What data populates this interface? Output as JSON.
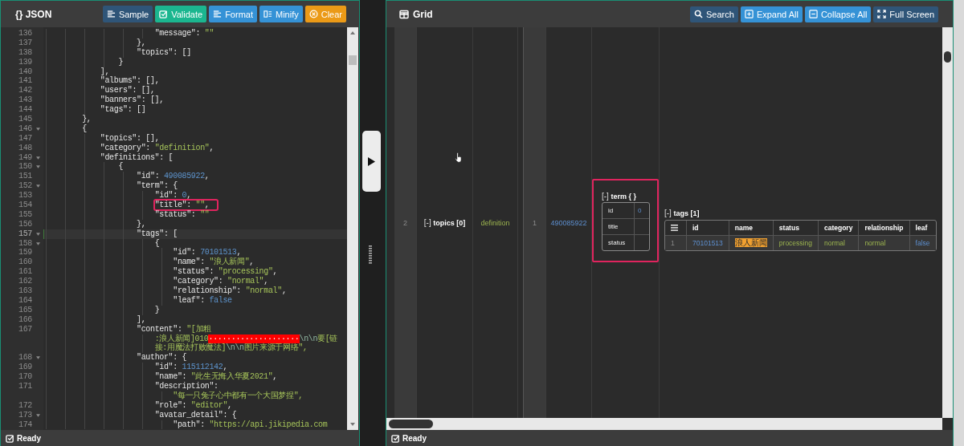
{
  "json_panel": {
    "title": "{} JSON",
    "buttons": [
      {
        "label": "Sample",
        "kind": "sample"
      },
      {
        "label": "Validate",
        "kind": "validate"
      },
      {
        "label": "Format",
        "kind": "format"
      },
      {
        "label": "Minify",
        "kind": "minify"
      },
      {
        "label": "Clear",
        "kind": "clear"
      }
    ],
    "lines": [
      {
        "kind": "code",
        "number": "136",
        "foldable": false,
        "active": false,
        "annotated": false,
        "text": "                        \"message\": \"\""
      },
      {
        "kind": "code",
        "number": "137",
        "foldable": false,
        "active": false,
        "annotated": false,
        "text": "                    },"
      },
      {
        "kind": "code",
        "number": "138",
        "foldable": false,
        "active": false,
        "annotated": false,
        "text": "                    \"topics\": []"
      },
      {
        "kind": "code",
        "number": "139",
        "foldable": false,
        "active": false,
        "annotated": false,
        "text": "                }"
      },
      {
        "kind": "code",
        "number": "140",
        "foldable": false,
        "active": false,
        "annotated": false,
        "text": "            ],"
      },
      {
        "kind": "code",
        "number": "141",
        "foldable": false,
        "active": false,
        "annotated": false,
        "text": "            \"albums\": [],"
      },
      {
        "kind": "code",
        "number": "142",
        "foldable": false,
        "active": false,
        "annotated": false,
        "text": "            \"users\": [],"
      },
      {
        "kind": "code",
        "number": "143",
        "foldable": false,
        "active": false,
        "annotated": false,
        "text": "            \"banners\": [],"
      },
      {
        "kind": "code",
        "number": "144",
        "foldable": false,
        "active": false,
        "annotated": false,
        "text": "            \"tags\": []"
      },
      {
        "kind": "code",
        "number": "145",
        "foldable": false,
        "active": false,
        "annotated": false,
        "text": "        },"
      },
      {
        "kind": "code",
        "number": "146",
        "foldable": true,
        "active": false,
        "annotated": false,
        "text": "        {"
      },
      {
        "kind": "code",
        "number": "147",
        "foldable": false,
        "active": false,
        "annotated": false,
        "text": "            \"topics\": [],"
      },
      {
        "kind": "code",
        "number": "148",
        "foldable": false,
        "active": false,
        "annotated": false,
        "text": "            \"category\": \"definition\","
      },
      {
        "kind": "code",
        "number": "149",
        "foldable": true,
        "active": false,
        "annotated": false,
        "text": "            \"definitions\": ["
      },
      {
        "kind": "code",
        "number": "150",
        "foldable": true,
        "active": false,
        "annotated": false,
        "text": "                {"
      },
      {
        "kind": "code",
        "number": "151",
        "foldable": false,
        "active": false,
        "annotated": false,
        "text": "                    \"id\": 490085922,"
      },
      {
        "kind": "code",
        "number": "152",
        "foldable": true,
        "active": false,
        "annotated": false,
        "text": "                    \"term\": {"
      },
      {
        "kind": "code",
        "number": "153",
        "foldable": false,
        "active": false,
        "annotated": false,
        "text": "                        \"id\": 0,"
      },
      {
        "kind": "code",
        "number": "154",
        "foldable": false,
        "active": false,
        "annotated": true,
        "text": "                        \"title\": \"\","
      },
      {
        "kind": "code",
        "number": "155",
        "foldable": false,
        "active": false,
        "annotated": false,
        "text": "                        \"status\": \"\""
      },
      {
        "kind": "code",
        "number": "156",
        "foldable": false,
        "active": false,
        "annotated": false,
        "text": "                    },"
      },
      {
        "kind": "code",
        "number": "157",
        "foldable": true,
        "active": true,
        "annotated": false,
        "text": "                    \"tags\": ["
      },
      {
        "kind": "code",
        "number": "158",
        "foldable": true,
        "active": false,
        "annotated": false,
        "text": "                        {"
      },
      {
        "kind": "code",
        "number": "159",
        "foldable": false,
        "active": false,
        "annotated": false,
        "text": "                            \"id\": 70101513,"
      },
      {
        "kind": "code",
        "number": "160",
        "foldable": false,
        "active": false,
        "annotated": false,
        "text": "                            \"name\": \"浪人新闻\","
      },
      {
        "kind": "code",
        "number": "161",
        "foldable": false,
        "active": false,
        "annotated": false,
        "text": "                            \"status\": \"processing\","
      },
      {
        "kind": "code",
        "number": "162",
        "foldable": false,
        "active": false,
        "annotated": false,
        "text": "                            \"category\": \"normal\","
      },
      {
        "kind": "code",
        "number": "163",
        "foldable": false,
        "active": false,
        "annotated": false,
        "text": "                            \"relationship\": \"normal\","
      },
      {
        "kind": "code",
        "number": "164",
        "foldable": false,
        "active": false,
        "annotated": false,
        "text": "                            \"leaf\": false"
      },
      {
        "kind": "code",
        "number": "165",
        "foldable": false,
        "active": false,
        "annotated": false,
        "text": "                        }"
      },
      {
        "kind": "code",
        "number": "166",
        "foldable": false,
        "active": false,
        "annotated": false,
        "text": "                    ],"
      },
      {
        "kind": "code",
        "number": "167",
        "foldable": false,
        "active": false,
        "annotated": false,
        "text": "                    \"content\": \"[加粗"
      },
      {
        "kind": "wrap",
        "text": "                        :浪人新闻]010····················\\n\\n要[链"
      },
      {
        "kind": "wrap",
        "text": "                        接:用魔法打败魔法]\\n\\n图片来源于网络\","
      },
      {
        "kind": "code",
        "number": "168",
        "foldable": true,
        "active": false,
        "annotated": false,
        "text": "                    \"author\": {"
      },
      {
        "kind": "code",
        "number": "169",
        "foldable": false,
        "active": false,
        "annotated": false,
        "text": "                        \"id\": 115112142,"
      },
      {
        "kind": "code",
        "number": "170",
        "foldable": false,
        "active": false,
        "annotated": false,
        "text": "                        \"name\": \"此生无悔入华夏2021\","
      },
      {
        "kind": "code",
        "number": "171",
        "foldable": false,
        "active": false,
        "annotated": false,
        "text": "                        \"description\":"
      },
      {
        "kind": "wrap",
        "text": "                            \"每一只兔子心中都有一个大国梦捏\","
      },
      {
        "kind": "code",
        "number": "172",
        "foldable": false,
        "active": false,
        "annotated": false,
        "text": "                        \"role\": \"editor\","
      },
      {
        "kind": "code",
        "number": "173",
        "foldable": true,
        "active": false,
        "annotated": false,
        "text": "                        \"avatar_detail\": {"
      },
      {
        "kind": "code",
        "number": "174",
        "foldable": false,
        "active": false,
        "annotated": false,
        "text": "                            \"path\": \"https://api.jikipedia.com"
      }
    ],
    "status": "Ready"
  },
  "grid_panel": {
    "title": "Grid",
    "buttons": [
      {
        "label": "Search",
        "kind": "search"
      },
      {
        "label": "Expand All",
        "kind": "expand"
      },
      {
        "label": "Collapse All",
        "kind": "collapse"
      },
      {
        "label": "Full Screen",
        "kind": "fullscreen"
      }
    ],
    "row": {
      "index": "2",
      "toggle": "[-]",
      "label": "topics [0]",
      "category": "definition",
      "definition": {
        "index": "1",
        "id": "490085922",
        "term": {
          "toggle": "[-]",
          "label": "term { }",
          "annotated": true,
          "rows": [
            {
              "key": "id",
              "value": "0"
            },
            {
              "key": "title"
            },
            {
              "key": "status"
            }
          ]
        },
        "tags": {
          "toggle": "[-]",
          "label": "tags [1]",
          "columns": [
            "id",
            "name",
            "status",
            "category",
            "relationship",
            "leaf"
          ],
          "rows": [
            {
              "index": "1",
              "cells": [
                {
                  "text": "70101513",
                  "kind": "number",
                  "highlighted": false
                },
                {
                  "text": "浪人新闻",
                  "kind": "string",
                  "highlighted": true
                },
                {
                  "text": "processing",
                  "kind": "string",
                  "highlighted": false
                },
                {
                  "text": "normal",
                  "kind": "string",
                  "highlighted": false
                },
                {
                  "text": "normal",
                  "kind": "string",
                  "highlighted": false
                },
                {
                  "text": "false",
                  "kind": "number",
                  "highlighted": false
                }
              ]
            }
          ]
        }
      }
    },
    "status": "Ready"
  }
}
